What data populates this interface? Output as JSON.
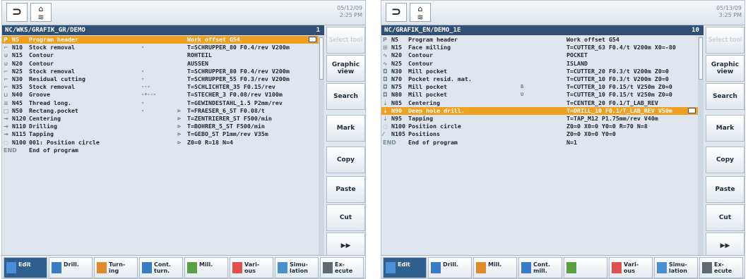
{
  "left": {
    "datetime": [
      "05/12/09",
      "2:25 PM"
    ],
    "path": "NC/WKS/GRAFIK_GR/DEMO",
    "path_num": "1",
    "rows": [
      {
        "icon": "P",
        "block": "N5",
        "desc": "Program header",
        "mark": "",
        "arrow": "",
        "value": "Work offset G54",
        "sel": true
      },
      {
        "icon": "⌐",
        "block": "N10",
        "desc": "Stock removal",
        "mark": "▿",
        "arrow": "",
        "value": "T=SCHRUPPER_80 F0.4/rev V200m"
      },
      {
        "icon": "∪",
        "block": "N15",
        "desc": "Contour",
        "mark": "",
        "arrow": "",
        "value": "ROHTEIL"
      },
      {
        "icon": "∪",
        "block": "N20",
        "desc": "Contour",
        "mark": "",
        "arrow": "",
        "value": "AUSSEN"
      },
      {
        "icon": "⌐",
        "block": "N25",
        "desc": "Stock removal",
        "mark": "▿",
        "arrow": "",
        "value": "T=SCHRUPPER_80 F0.4/rev V200m"
      },
      {
        "icon": "⌐",
        "block": "N30",
        "desc": "Residual cutting",
        "mark": "▿",
        "arrow": "",
        "value": "T=SCHRUPPER_55 F0.3/rev V200m"
      },
      {
        "icon": "⌐",
        "block": "N35",
        "desc": "Stock removal",
        "mark": "▿▿▿",
        "arrow": "",
        "value": "T=SCHLICHTER_35 F0.15/rev"
      },
      {
        "icon": "⊔",
        "block": "N40",
        "desc": "Groove",
        "mark": "▿+▿▿▿",
        "arrow": "",
        "value": "T=STECHER_3 F0.08/rev V100m"
      },
      {
        "icon": "≋",
        "block": "N45",
        "desc": "Thread long.",
        "mark": "▿",
        "arrow": "",
        "value": "T=GEWINDESTAHL_1.5 P2mm/rev"
      },
      {
        "icon": "□",
        "block": "N50",
        "desc": "Rectang.pocket",
        "mark": "▿",
        "arrow": "⊳",
        "value": "T=FRAESER_6_ST F0.08/t"
      },
      {
        "icon": "⇥",
        "block": "N120",
        "desc": "Centering",
        "mark": "",
        "arrow": "⊳",
        "value": "T=ZENTRIERER_ST F500/min"
      },
      {
        "icon": "⇥",
        "block": "N110",
        "desc": "Drilling",
        "mark": "",
        "arrow": "⊳",
        "value": "T=BOHRER_5_ST F500/min"
      },
      {
        "icon": "⇥",
        "block": "N115",
        "desc": "Tapping",
        "mark": "",
        "arrow": "⊳",
        "value": "T=GEBO_ST P1mm/rev V35m"
      },
      {
        "icon": "◌",
        "block": "N100",
        "desc": "001: Position circle",
        "mark": "",
        "arrow": "⊳",
        "value": "Z0=0 R=18 N=4"
      },
      {
        "icon": "END",
        "block": "",
        "desc": "End of program",
        "mark": "",
        "arrow": "",
        "value": ""
      }
    ],
    "softkeys": [
      "Select tool",
      "Graphic view",
      "Search",
      "Mark",
      "Copy",
      "Paste",
      "Cut",
      "▶▶"
    ],
    "bottom": [
      {
        "label": "Edit",
        "active": true
      },
      {
        "label": "Drill.",
        "active": false
      },
      {
        "label": "Turn-\ning",
        "active": false
      },
      {
        "label": "Cont.\nturn.",
        "active": false
      },
      {
        "label": "Mill.",
        "active": false
      },
      {
        "label": "Vari-\nous",
        "active": false
      },
      {
        "label": "Simu-\nlation",
        "active": false
      },
      {
        "label": "Ex-\necute",
        "active": false
      }
    ]
  },
  "right": {
    "datetime": [
      "05/13/09",
      "3:25 PM"
    ],
    "path": "NC/GRAFIK_EN/DEMO_1E",
    "path_num": "10",
    "rows": [
      {
        "icon": "P",
        "block": "N5",
        "desc": "Program header",
        "mark": "",
        "arrow": "",
        "value": "Work offset G54"
      },
      {
        "icon": "⊞",
        "block": "N15",
        "desc": "Face milling",
        "mark": "",
        "arrow": "",
        "value": "T=CUTTER_63 F0.4/t V200m X0=-80"
      },
      {
        "icon": "∿",
        "block": "N20",
        "desc": "Contour",
        "mark": "",
        "arrow": "",
        "value": "POCKET"
      },
      {
        "icon": "∿",
        "block": "N25",
        "desc": "Contour",
        "mark": "",
        "arrow": "",
        "value": "ISLAND"
      },
      {
        "icon": "◘",
        "block": "N30",
        "desc": "Mill pocket",
        "mark": "",
        "arrow": "",
        "value": "T=CUTTER_20 F0.3/t V200m Z0=0"
      },
      {
        "icon": "◘",
        "block": "N70",
        "desc": "Pocket resid. mat.",
        "mark": "",
        "arrow": "",
        "value": "T=CUTTER_10 F0.3/t V200m Z0=0"
      },
      {
        "icon": "◘",
        "block": "N75",
        "desc": "Mill pocket",
        "mark": "B",
        "arrow": "",
        "value": "T=CUTTER_10 F0.15/t V250m Z0=0"
      },
      {
        "icon": "◘",
        "block": "N80",
        "desc": "Mill pocket",
        "mark": "U",
        "arrow": "",
        "value": "T=CUTTER_10 F0.15/t V250m Z0=0"
      },
      {
        "icon": "⇣",
        "block": "N85",
        "desc": "Centering",
        "mark": "",
        "arrow": "",
        "value": "T=CENTER_20 F0.1/T_LAB_REV"
      },
      {
        "icon": "⇣",
        "block": "N90",
        "desc": "Deep hole drill.",
        "mark": "",
        "arrow": "",
        "value": "T=DRILL_10 F0.1/T_LAB_REV V50m",
        "sel": true
      },
      {
        "icon": "⇣",
        "block": "N95",
        "desc": "Tapping",
        "mark": "",
        "arrow": "",
        "value": "T=TAP_M12 P1.75mm/rev V40m"
      },
      {
        "icon": "◌",
        "block": "N100",
        "desc": "Position circle",
        "mark": "",
        "arrow": "",
        "value": "Z0=0 X0=0 Y0=0 R=70 N=8"
      },
      {
        "icon": "⁄",
        "block": "N105",
        "desc": "Positions",
        "mark": "",
        "arrow": "",
        "value": "Z0=0 X0=0 Y0=0"
      },
      {
        "icon": "END",
        "block": "",
        "desc": "End of program",
        "mark": "",
        "arrow": "",
        "value": "N=1"
      }
    ],
    "softkeys": [
      "Select tool",
      "Graphic view",
      "Search",
      "Mark",
      "Copy",
      "Paste",
      "Cut",
      "▶▶"
    ],
    "bottom": [
      {
        "label": "Edit",
        "active": true
      },
      {
        "label": "Drill.",
        "active": false
      },
      {
        "label": "Mill.",
        "active": false
      },
      {
        "label": "Cont.\nmill.",
        "active": false
      },
      {
        "label": "",
        "active": false
      },
      {
        "label": "Vari-\nous",
        "active": false
      },
      {
        "label": "Simu-\nlation",
        "active": false
      },
      {
        "label": "Ex-\necute",
        "active": false
      }
    ]
  },
  "colors": {
    "accent": "#f0a020",
    "header": "#2f4f74",
    "panel": "#dfe6ee"
  }
}
